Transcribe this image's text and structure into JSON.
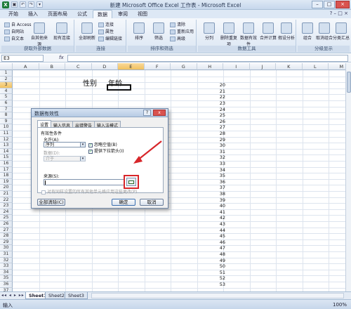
{
  "window": {
    "title": "新建 Microsoft Office Excel 工作表 - Microsoft Excel",
    "logo_letter": "X",
    "qat": [
      "▣",
      "↶",
      "↷",
      "▾"
    ],
    "controls": [
      "–",
      "□",
      "×"
    ]
  },
  "ribbon": {
    "tabs": [
      "开始",
      "插入",
      "页面布局",
      "公式",
      "数据",
      "审阅",
      "视图"
    ],
    "active_tab": "数据",
    "help_icons": [
      "?",
      "–",
      "□",
      "×"
    ],
    "groups": [
      {
        "label": "获取外部数据",
        "buttons": [
          "自 Access",
          "自网站",
          "自文本",
          "自其他来源",
          "现有连接"
        ]
      },
      {
        "label": "连接",
        "buttons": [
          "全部刷新",
          "连接",
          "属性",
          "编辑链接"
        ]
      },
      {
        "label": "排序和筛选",
        "buttons": [
          "排序",
          "筛选",
          "清除",
          "重新应用",
          "高级"
        ]
      },
      {
        "label": "数据工具",
        "buttons": [
          "分列",
          "删除重复项",
          "数据有效性",
          "合并计算",
          "假设分析"
        ]
      },
      {
        "label": "分级显示",
        "buttons": [
          "组合",
          "取消组合",
          "分类汇总"
        ]
      }
    ]
  },
  "formula_bar": {
    "name_box": "E3",
    "fx": "fx",
    "value": ""
  },
  "grid": {
    "columns": [
      "A",
      "B",
      "C",
      "D",
      "E",
      "F",
      "G",
      "H",
      "I",
      "J",
      "K",
      "L",
      "M"
    ],
    "selected_column": "E",
    "rows": [
      "1",
      "2",
      "3",
      "4",
      "5",
      "6",
      "7",
      "8",
      "9",
      "10",
      "11",
      "12",
      "13",
      "14",
      "15",
      "16",
      "17",
      "18",
      "19",
      "20",
      "21",
      "22",
      "23",
      "24",
      "25",
      "26",
      "27",
      "28",
      "29",
      "30",
      "31",
      "32",
      "33",
      "34",
      "35",
      "36",
      "37"
    ],
    "selected_row": "3",
    "header_d2": "性别",
    "header_e2": "年龄",
    "column_i_values": [
      "20",
      "21",
      "22",
      "23",
      "24",
      "25",
      "26",
      "27",
      "28",
      "29",
      "30",
      "31",
      "32",
      "33",
      "34",
      "35",
      "36",
      "37",
      "38",
      "39",
      "40",
      "41",
      "42",
      "43",
      "44",
      "45",
      "46",
      "47",
      "48",
      "49",
      "50",
      "51",
      "52",
      "53"
    ]
  },
  "dialog": {
    "title": "数据有效性",
    "help": "?",
    "close": "x",
    "tabs": [
      "设置",
      "输入信息",
      "出错警告",
      "输入法模式"
    ],
    "active_tab": "设置",
    "section_label": "有效性条件",
    "allow_label": "允许(A):",
    "allow_value": "序列",
    "data_label": "数据(D):",
    "data_value": "介于",
    "ignore_blank_label": "忽略空值(B)",
    "ignore_blank_checked": true,
    "dropdown_label": "提供下拉箭头(I)",
    "dropdown_checked": true,
    "source_label": "来源(S):",
    "source_value": "",
    "apply_all_label": "对有同样设置的所有其他单元格应用这些更改(P)",
    "apply_all_checked": false,
    "clear_all_button": "全部清除(C)",
    "ok_button": "确定",
    "cancel_button": "取消",
    "check_mark": "✓",
    "dropdown_arrow": "▾"
  },
  "sheets": {
    "nav": "◂◂ ◂ ▸ ▸▸",
    "tabs": [
      "Sheet1",
      "Sheet2",
      "Sheet3"
    ],
    "active": "Sheet1"
  },
  "status": {
    "mode": "输入",
    "zoom": "100%"
  },
  "colors": {
    "annotation_red": "#d7262a",
    "selection_accent": "#f1c15f"
  }
}
